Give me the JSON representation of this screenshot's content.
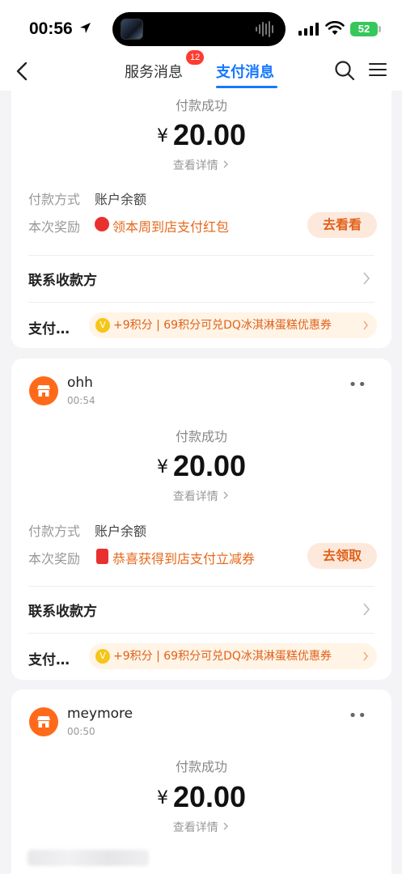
{
  "status_bar": {
    "time": "00:56",
    "battery": "52"
  },
  "nav": {
    "tabs": [
      {
        "label": "服务消息",
        "badge": "12"
      },
      {
        "label": "支付消息",
        "active": true
      }
    ]
  },
  "cards": [
    {
      "status": "付款成功",
      "currency": "¥",
      "amount": "20.00",
      "view_detail": "查看详情",
      "pay_method_label": "付款方式",
      "pay_method_value": "账户余额",
      "reward_label": "本次奖励",
      "reward_text": "领本周到店支付红包",
      "reward_button": "去看看",
      "contact_label": "联系收款方",
      "points_label": "支付…",
      "points_text": "+9积分 | 69积分可兑DQ冰淇淋蛋糕优惠券"
    },
    {
      "merchant": "ohh",
      "time": "00:54",
      "status": "付款成功",
      "currency": "¥",
      "amount": "20.00",
      "view_detail": "查看详情",
      "pay_method_label": "付款方式",
      "pay_method_value": "账户余额",
      "reward_label": "本次奖励",
      "reward_text": "恭喜获得到店支付立减券",
      "reward_button": "去领取",
      "contact_label": "联系收款方",
      "points_label": "支付…",
      "points_text": "+9积分 | 69积分可兑DQ冰淇淋蛋糕优惠券"
    },
    {
      "merchant": "meymore",
      "time": "00:50",
      "status": "付款成功",
      "currency": "¥",
      "amount": "20.00",
      "view_detail": "查看详情"
    }
  ],
  "colors": {
    "accent": "#1677ff",
    "orange": "#e0611a",
    "badge": "#ff3b30"
  }
}
